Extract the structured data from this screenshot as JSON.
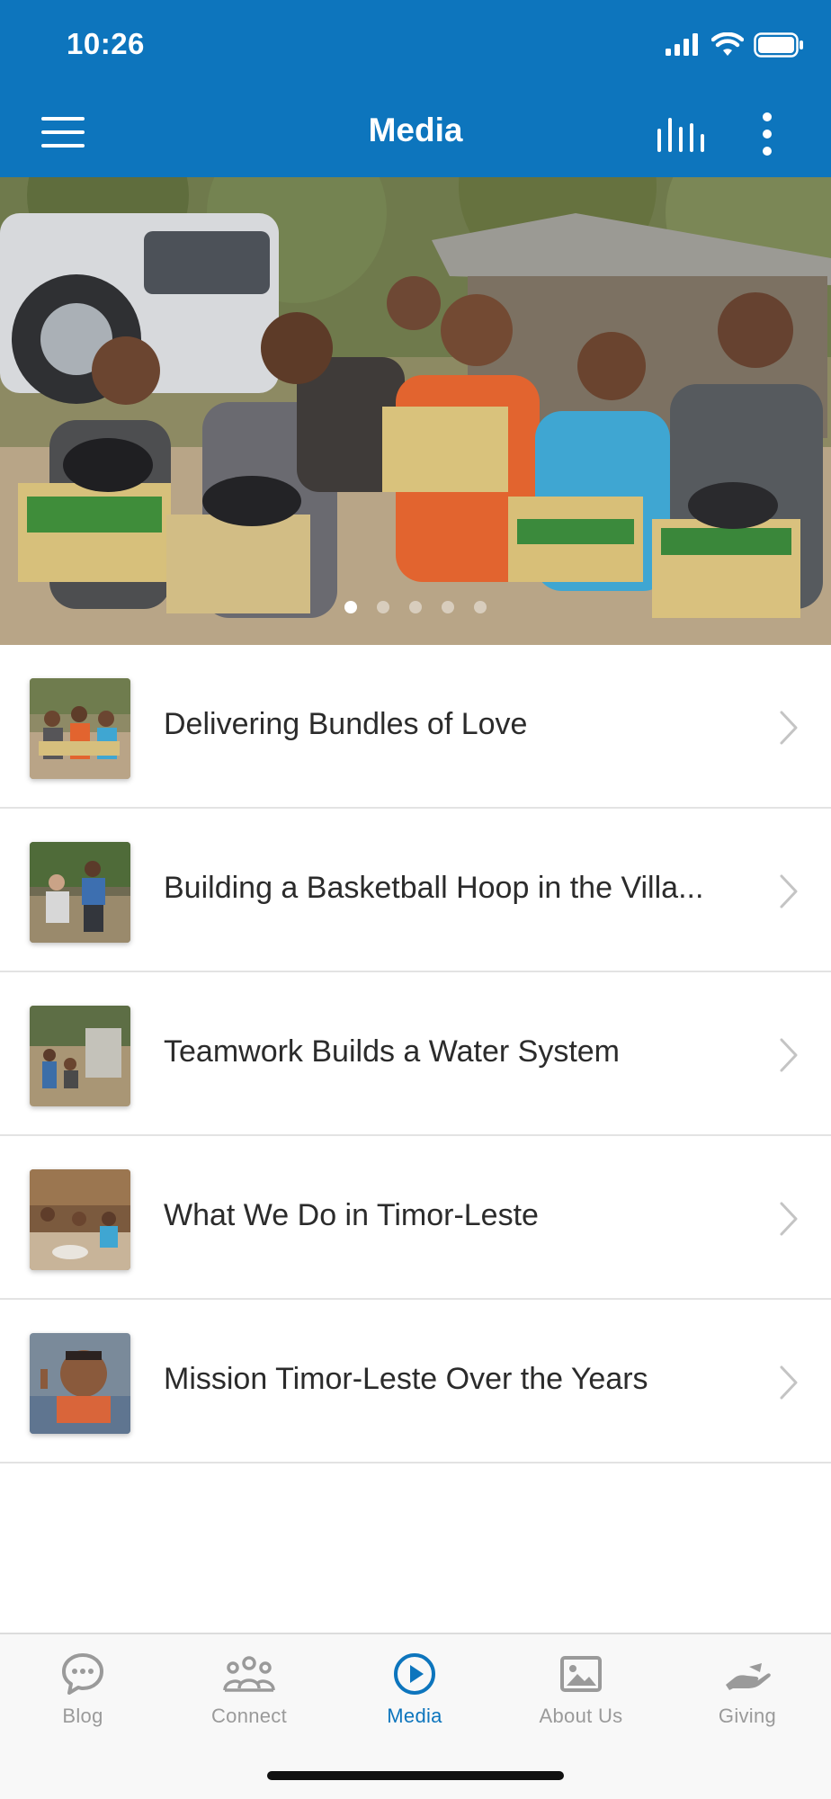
{
  "status_bar": {
    "time": "10:26"
  },
  "header": {
    "title": "Media",
    "background_color": "#0d75bd",
    "menu_icon": "hamburger-menu-icon",
    "chart_icon": "bar-chart-icon",
    "more_icon": "vertical-ellipsis-icon"
  },
  "hero": {
    "description_image": "children-holding-boxes-photo",
    "carousel": {
      "count": 5,
      "active_index": 0
    }
  },
  "media_items": [
    {
      "title": "Delivering Bundles of Love"
    },
    {
      "title": "Building a Basketball Hoop in the Villa..."
    },
    {
      "title": "Teamwork Builds a Water System"
    },
    {
      "title": "What We Do in Timor-Leste"
    },
    {
      "title": "Mission Timor-Leste Over the Years"
    }
  ],
  "tab_bar": {
    "active_color": "#0d75bd",
    "inactive_color": "#9a9a9a",
    "tabs": [
      {
        "label": "Blog",
        "icon": "chat-bubble-icon",
        "active": false
      },
      {
        "label": "Connect",
        "icon": "people-group-icon",
        "active": false
      },
      {
        "label": "Media",
        "icon": "play-circle-icon",
        "active": true
      },
      {
        "label": "About Us",
        "icon": "image-icon",
        "active": false
      },
      {
        "label": "Giving",
        "icon": "giving-hand-icon",
        "active": false
      }
    ]
  }
}
